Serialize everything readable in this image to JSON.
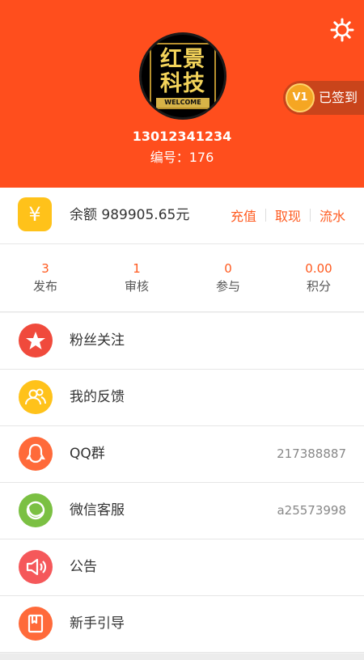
{
  "header": {
    "phone": "13012341234",
    "uid_label": "编号：176",
    "avatar": {
      "line1": "红景",
      "line2": "科技",
      "banner": "WELCOME"
    },
    "vip": {
      "level": "V1",
      "status": "已签到"
    },
    "settings_icon": "gear-icon"
  },
  "balance": {
    "icon": "yen-icon",
    "label": "余额 989905.65元",
    "actions": [
      "充值",
      "取现",
      "流水"
    ]
  },
  "stats": [
    {
      "value": "3",
      "label": "发布"
    },
    {
      "value": "1",
      "label": "审核"
    },
    {
      "value": "0",
      "label": "参与"
    },
    {
      "value": "0.00",
      "label": "积分"
    }
  ],
  "menu": [
    {
      "label": "粉丝关注",
      "value": "",
      "icon": "star-icon",
      "color": "#f04a3c"
    },
    {
      "label": "我的反馈",
      "value": "",
      "icon": "users-icon",
      "color": "#ffc21a"
    },
    {
      "label": "QQ群",
      "value": "217388887",
      "icon": "qq-icon",
      "color": "#ff6a3a"
    },
    {
      "label": "微信客服",
      "value": "a25573998",
      "icon": "chat-icon",
      "color": "#7bc043"
    },
    {
      "label": "公告",
      "value": "",
      "icon": "speaker-icon",
      "color": "#f5585a"
    },
    {
      "label": "新手引导",
      "value": "",
      "icon": "book-icon",
      "color": "#ff6a3a"
    }
  ],
  "colors": {
    "brand": "#ff4e1d",
    "accent": "#ff5a1f"
  }
}
